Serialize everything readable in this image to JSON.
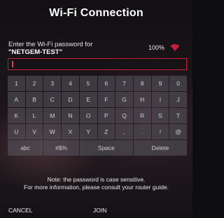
{
  "dialog": {
    "title": "Wi-Fi Connection",
    "prompt_line1": "Enter the Wi-Fi password for",
    "ssid": "\"NETGEM-TEST\"",
    "signal_strength": "100%",
    "password_value": "",
    "accent_color": "#c51d3c"
  },
  "keyboard": {
    "rows": [
      [
        "1",
        "2",
        "3",
        "4",
        "5",
        "6",
        "7",
        "8",
        "9",
        "0"
      ],
      [
        "A",
        "B",
        "C",
        "D",
        "E",
        "F",
        "G",
        "H",
        "I",
        "J"
      ],
      [
        "K",
        "L",
        "M",
        "N",
        "O",
        "P",
        "Q",
        "R",
        "S",
        "T"
      ],
      [
        "U",
        "V",
        "W",
        "X",
        "Y",
        "Z",
        ",",
        ".",
        "!",
        "@"
      ]
    ],
    "bottom_row": {
      "abc": "abc",
      "symbols": "#$%",
      "space": "Space",
      "delete": "Delete"
    }
  },
  "note": {
    "line1": "Note: the password is case sensitive.",
    "line2": "For more information, please consult your router guide."
  },
  "actions": {
    "cancel": "CANCEL",
    "join": "JOIN"
  },
  "icons": {
    "signal": "wifi-signal-icon"
  }
}
